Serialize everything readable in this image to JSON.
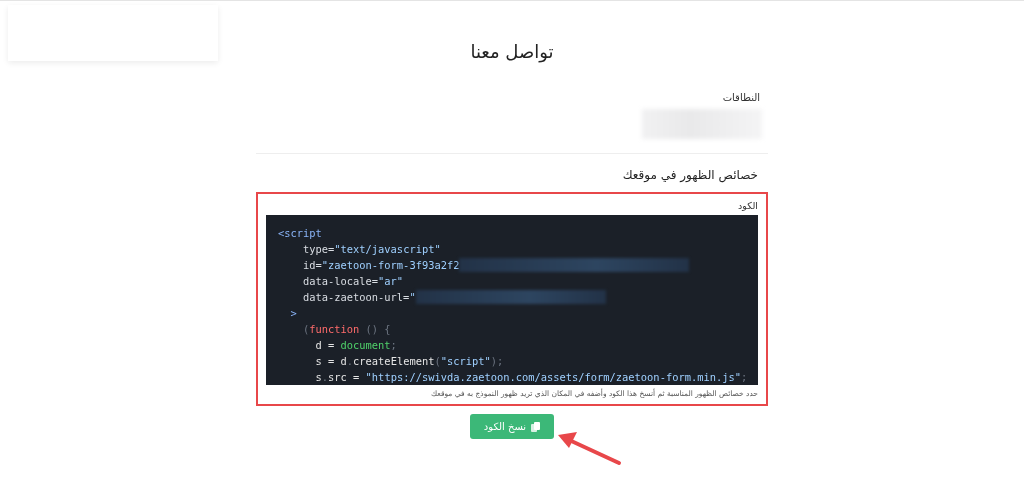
{
  "title": "تواصل معنا",
  "domains": {
    "label": "النطاقات",
    "value_redacted": true
  },
  "section_heading": "خصائص الظهور في موقعك",
  "code_box": {
    "highlighted": true,
    "label": "الكود",
    "lines": [
      [
        {
          "kind": "tag",
          "text": "<script"
        }
      ],
      [
        {
          "kind": "attr",
          "text": "    type="
        },
        {
          "kind": "string",
          "text": "\"text/javascript\""
        }
      ],
      [
        {
          "kind": "attr",
          "text": "    id="
        },
        {
          "kind": "string",
          "text": "\"zaetoon-form-3f93a2f2"
        },
        {
          "kind": "redacted"
        }
      ],
      [
        {
          "kind": "attr",
          "text": "    data-locale="
        },
        {
          "kind": "string",
          "text": "\"ar\""
        }
      ],
      [
        {
          "kind": "attr",
          "text": "    data-zaetoon-url="
        },
        {
          "kind": "string",
          "text": "\""
        },
        {
          "kind": "redacted"
        }
      ],
      [
        {
          "kind": "tag",
          "text": "  >"
        }
      ],
      [
        {
          "kind": "punct",
          "text": "    ("
        },
        {
          "kind": "keyword",
          "text": "function"
        },
        {
          "kind": "punct",
          "text": " () {"
        }
      ],
      [
        {
          "kind": "plain",
          "text": "      d = "
        },
        {
          "kind": "builtin",
          "text": "document"
        },
        {
          "kind": "punct",
          "text": ";"
        }
      ],
      [
        {
          "kind": "plain",
          "text": "      s = d"
        },
        {
          "kind": "punct",
          "text": "."
        },
        {
          "kind": "plain",
          "text": "createElement"
        },
        {
          "kind": "punct",
          "text": "("
        },
        {
          "kind": "string",
          "text": "\"script\""
        },
        {
          "kind": "punct",
          "text": ");"
        }
      ],
      [
        {
          "kind": "plain",
          "text": "      s"
        },
        {
          "kind": "punct",
          "text": "."
        },
        {
          "kind": "plain",
          "text": "src = "
        },
        {
          "kind": "string",
          "text": "\"https://swivda.zaetoon.com/assets/form/zaetoon-form.min.js\""
        },
        {
          "kind": "punct",
          "text": ";"
        }
      ]
    ],
    "help": "حدد خصائص الظهور المناسبة ثم أنسخ هذا الكود وأضفه في المكان الذي تريد ظهور النموذج به في موقعك"
  },
  "copy_button": {
    "label": "نسخ الكود"
  }
}
